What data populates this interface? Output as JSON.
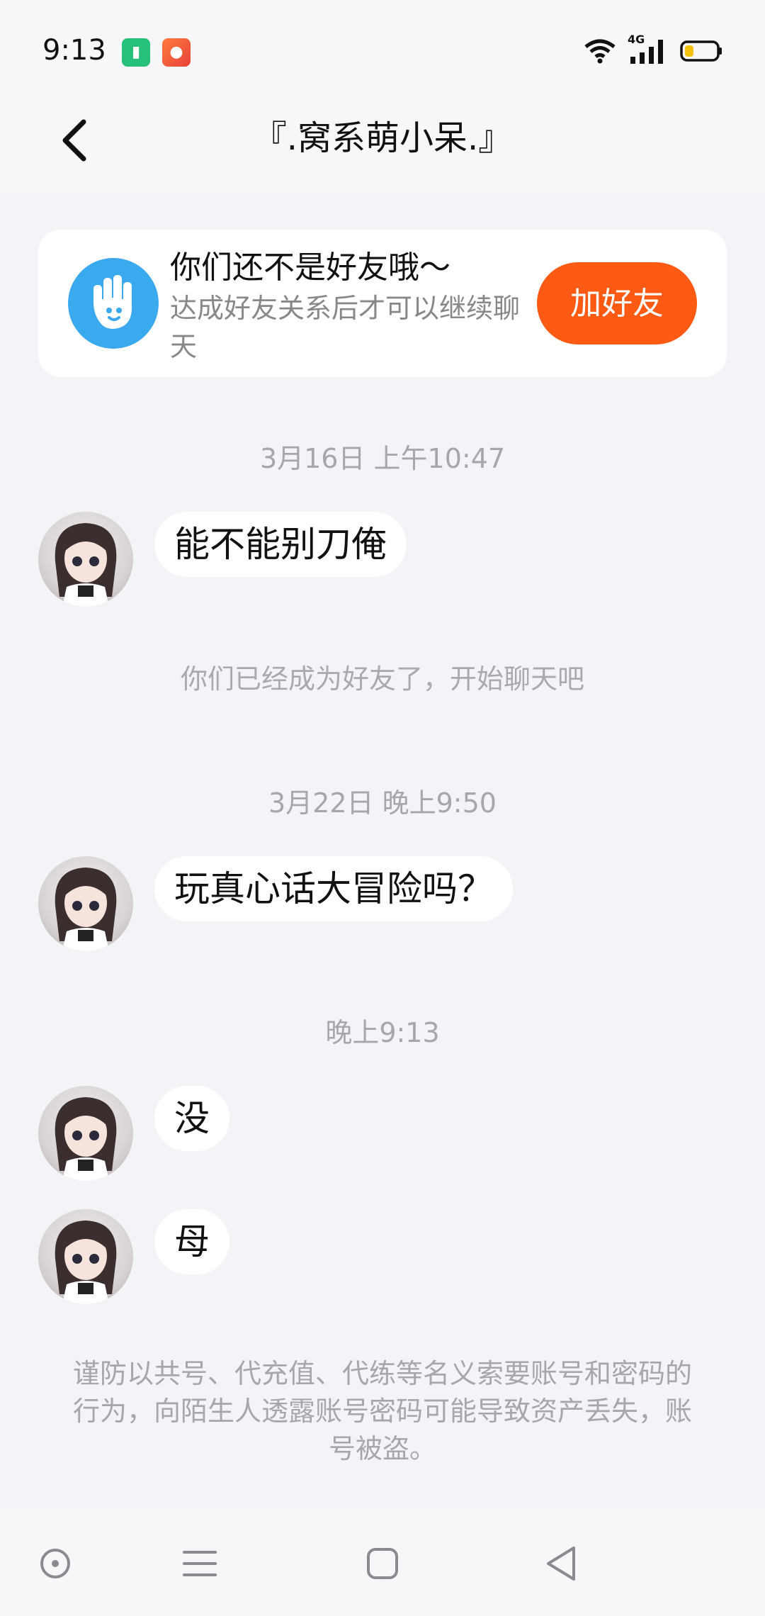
{
  "status_bar": {
    "time": "9:13",
    "network": "4G",
    "icons": [
      "battery-app-icon",
      "video-app-icon",
      "wifi-icon",
      "signal-icon",
      "battery-icon"
    ]
  },
  "header": {
    "title": "『.窝系萌小呆.』",
    "back_icon": "chevron-left-icon"
  },
  "friend_banner": {
    "title": "你们还不是好友哦～",
    "subtitle": "达成好友关系后才可以继续聊天",
    "button_label": "加好友",
    "icon": "waving-hand-icon",
    "accent_color": "#ff5a13"
  },
  "messages": [
    {
      "type": "time",
      "text": "3月16日 上午10:47"
    },
    {
      "type": "incoming",
      "text": "能不能别刀俺"
    },
    {
      "type": "system",
      "text": "你们已经成为好友了，开始聊天吧"
    },
    {
      "type": "time",
      "text": "3月22日 晚上9:50"
    },
    {
      "type": "incoming",
      "text": "玩真心话大冒险吗？"
    },
    {
      "type": "time",
      "text": "晚上9:13"
    },
    {
      "type": "incoming",
      "text": "没"
    },
    {
      "type": "incoming",
      "text": "母"
    }
  ],
  "security_notice": "谨防以共号、代充值、代练等名义索要账号和密码的行为，向陌生人透露账号密码可能导致资产丢失，账号被盗。",
  "nav_bar": {
    "icons": [
      "assistant-dot-icon",
      "menu-lines-icon",
      "home-square-icon",
      "back-triangle-icon"
    ]
  }
}
